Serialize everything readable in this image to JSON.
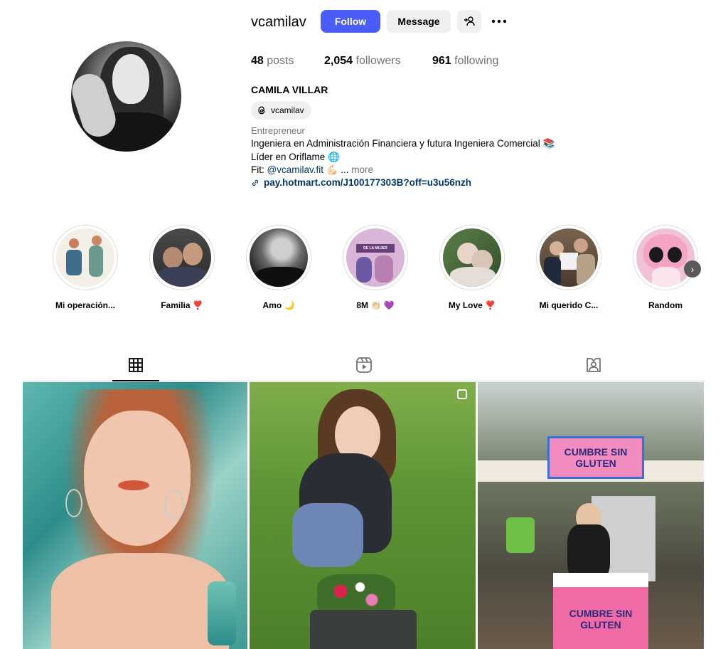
{
  "profile": {
    "username": "vcamilav",
    "follow_label": "Follow",
    "message_label": "Message",
    "posts_count": "48",
    "posts_label": "posts",
    "followers_count": "2,054",
    "followers_label": "followers",
    "following_count": "961",
    "following_label": "following",
    "full_name": "CAMILA VILLAR",
    "threads_handle": "vcamilav",
    "category": "Entrepreneur",
    "bio_line1": "Ingeniera en Administración Financiera y futura Ingeniera Comercial 📚",
    "bio_line2": "Líder en Oriflame 🌐",
    "bio_line3_prefix": "Fit: ",
    "bio_mention": "@vcamilav.fit",
    "bio_line3_suffix": " 💪🏻 ...",
    "more_label": " more",
    "link": "pay.hotmart.com/J100177303B?off=u3u56nzh"
  },
  "highlights": [
    {
      "label": "Mi operación..."
    },
    {
      "label": "Familia ❣️"
    },
    {
      "label": "Amo 🌙"
    },
    {
      "label": "8M 👏🏻 💜"
    },
    {
      "label": "My Love ❣️"
    },
    {
      "label": "Mi querido C..."
    },
    {
      "label": "Random"
    }
  ],
  "tabs": [
    {
      "icon": "grid-icon",
      "active": true
    },
    {
      "icon": "reels-icon",
      "active": false
    },
    {
      "icon": "tagged-icon",
      "active": false
    }
  ],
  "posts": [
    {
      "label": "post-mermaid"
    },
    {
      "label": "post-grass-flowers"
    },
    {
      "label": "post-cumbre-sin-gluten"
    }
  ],
  "post3_sign": "CUMBRE SIN GLUTEN",
  "post2_sign": "DE LA MUJER",
  "colors": {
    "follow": "#4a5df9",
    "secondary_button": "#efefef",
    "link": "#00376b",
    "muted": "#737373"
  }
}
